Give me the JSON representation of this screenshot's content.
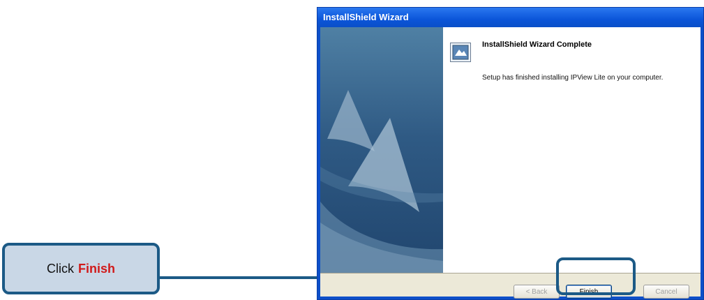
{
  "callout": {
    "prefix": "Click",
    "keyword": "Finish"
  },
  "window": {
    "title": "InstallShield Wizard",
    "heading": "InstallShield Wizard Complete",
    "message": "Setup has finished installing IPView Lite on your computer."
  },
  "buttons": {
    "back": "< Back",
    "finish": "Finish",
    "cancel": "Cancel"
  },
  "colors": {
    "callout_border": "#1c5a86",
    "keyword": "#d11a1a",
    "titlebar": "#0b55d9"
  }
}
